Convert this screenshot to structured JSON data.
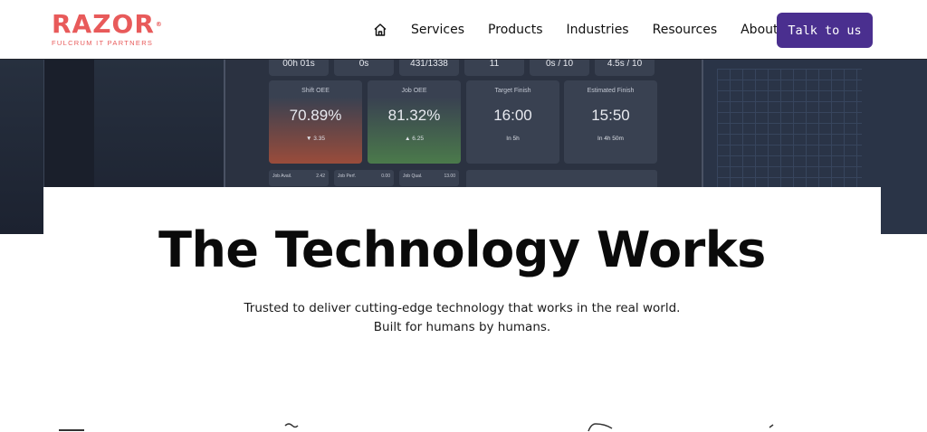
{
  "brand": {
    "name": "RAZOR",
    "tagline": "FULCRUM IT PARTNERS",
    "color": "#e85a5a"
  },
  "nav": {
    "home_icon": "home-icon",
    "items": [
      "Services",
      "Products",
      "Industries",
      "Resources",
      "About"
    ],
    "cta": "Talk to us",
    "cta_color": "#4a2f8f"
  },
  "hero_dashboard": {
    "top_row": [
      "00h 01s",
      "0s",
      "431/1338",
      "11",
      "0s / 10",
      "4.5s / 10"
    ],
    "tiles": [
      {
        "label": "Shift OEE",
        "value": "70.89%",
        "delta": "3.35"
      },
      {
        "label": "Job OEE",
        "value": "81.32%",
        "delta": "6.25"
      },
      {
        "label": "Target Finish",
        "value": "16:00",
        "note": "In 5h"
      },
      {
        "label": "Estimated Finish",
        "value": "15:50",
        "note": "In 4h 50m"
      }
    ],
    "mini": [
      {
        "label": "Job Avail.",
        "value": "2.42"
      },
      {
        "label": "Job Perf.",
        "value": "0.00"
      },
      {
        "label": "Job Qual.",
        "value": "13.00"
      }
    ]
  },
  "main": {
    "headline": "The Technology Works",
    "subtext": "Trusted to deliver cutting-edge technology that works in the real world. Built for humans by humans."
  }
}
